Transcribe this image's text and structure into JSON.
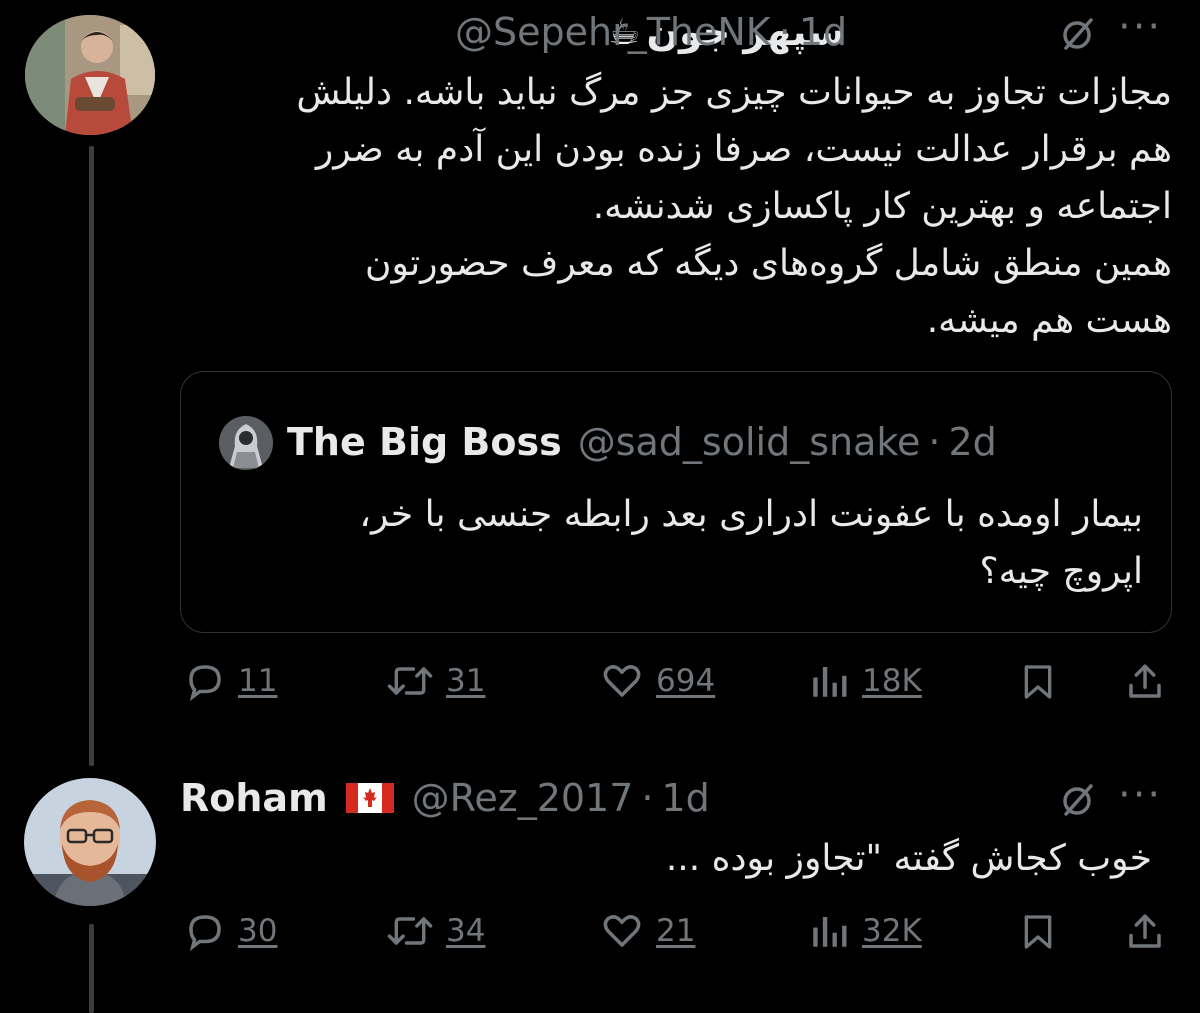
{
  "tweet1": {
    "display_name": "سپهر جون",
    "emoji": "☕",
    "handle": "@Sepehr_TheNK",
    "time": "1d",
    "lines": [
      "مجازات تجاوز به حیوانات چیزی جز مرگ نباید باشه. دلیلش",
      "هم برقرار عدالت نیست، صرفا زنده بودن این آدم به ضرر",
      "اجتماعه و بهترین کار پاکسازی شدنشه.",
      "همین منطق شامل گروه‌های دیگه که معرف حضورتون",
      "هست هم میشه."
    ],
    "quote": {
      "display_name": "The Big Boss",
      "handle": "@sad_solid_snake",
      "time": "2d",
      "lines": [
        "بیمار اومده با عفونت ادراری بعد رابطه جنسی با خر،",
        "اپروچ چیه؟"
      ]
    },
    "stats": {
      "replies": "11",
      "retweets": "31",
      "likes": "694",
      "views": "18K"
    }
  },
  "tweet2": {
    "display_name": "Roham",
    "flag": "🇨🇦",
    "handle": "@Rez_2017",
    "time": "1d",
    "lines": [
      "خوب کجاش گفته \"تجاوز بوده ..."
    ],
    "stats": {
      "replies": "30",
      "retweets": "34",
      "likes": "21",
      "views": "32K"
    }
  },
  "ui": {
    "dot": "·",
    "more": "···"
  },
  "icons": [
    "grok-icon",
    "more-icon",
    "reply-icon",
    "retweet-icon",
    "like-icon",
    "views-icon",
    "bookmark-icon",
    "share-icon"
  ],
  "colors": {
    "background": "#000000",
    "text": "#e7e9ea",
    "muted": "#71767b",
    "border": "#2f3336"
  }
}
